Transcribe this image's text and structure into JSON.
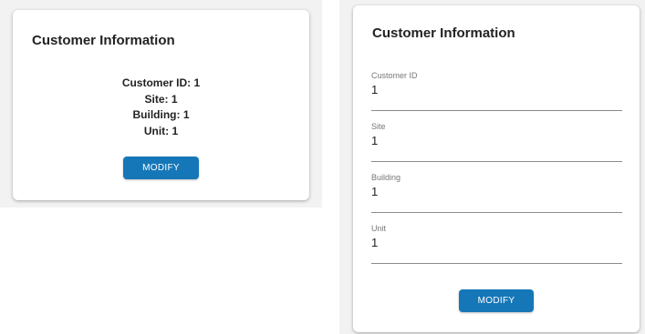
{
  "view_card": {
    "title": "Customer Information",
    "lines": [
      "Customer ID: 1",
      "Site: 1",
      "Building: 1",
      "Unit: 1"
    ],
    "modify_label": "MODIFY"
  },
  "edit_card": {
    "title": "Customer Information",
    "fields": [
      {
        "label": "Customer ID",
        "value": "1"
      },
      {
        "label": "Site",
        "value": "1"
      },
      {
        "label": "Building",
        "value": "1"
      },
      {
        "label": "Unit",
        "value": "1"
      }
    ],
    "modify_label": "MODIFY"
  },
  "colors": {
    "accent": "#1677b8",
    "text": "#222222",
    "label": "#777777",
    "backdrop": "#f2f2f2"
  }
}
